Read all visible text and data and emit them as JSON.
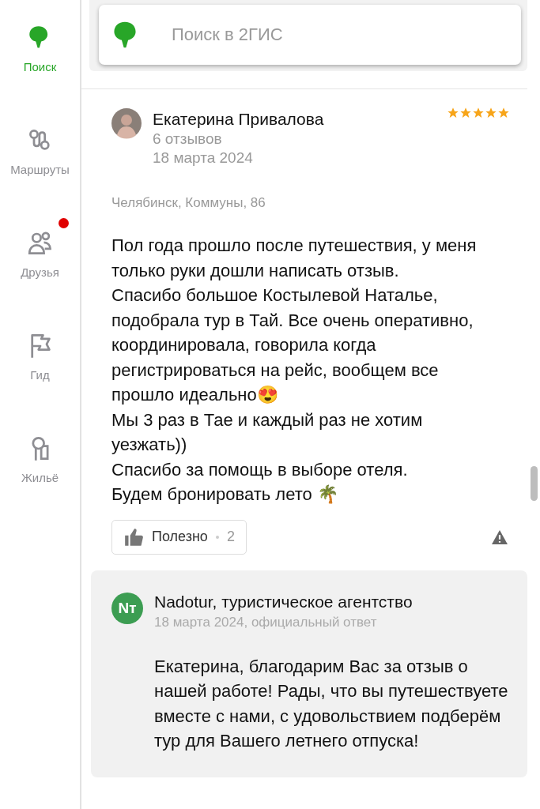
{
  "sidebar": {
    "items": [
      {
        "label": "Поиск",
        "kind": "search",
        "selected": true,
        "notification": false
      },
      {
        "label": "Маршруты",
        "kind": "routes",
        "selected": false,
        "notification": false
      },
      {
        "label": "Друзья",
        "kind": "friends",
        "selected": false,
        "notification": true
      },
      {
        "label": "Гид",
        "kind": "guide",
        "selected": false,
        "notification": false
      },
      {
        "label": "Жильё",
        "kind": "housing",
        "selected": false,
        "notification": false
      }
    ]
  },
  "search": {
    "placeholder": "Поиск в 2ГИС"
  },
  "review": {
    "author": "Екатерина Привалова",
    "reviews_count": "6 отзывов",
    "date": "18 марта 2024",
    "stars": 5,
    "address": "Челябинск, Коммуны, 86",
    "text": "Пол года прошло после путешествия, у меня только руки дошли написать отзыв.\nСпасибо большое Костылевой Наталье, подобрала тур в Тай. Все очень оперативно, координировала, говорила когда регистрироваться на рейс, вообщем все прошло идеально😍\nМы 3 раз в Тае и каждый раз не хотим уезжать))\nСпасибо за помощь в выборе отеля.\nБудем бронировать лето 🌴",
    "helpful": {
      "label": "Полезно",
      "count": "2"
    }
  },
  "reply": {
    "avatar": "Nт",
    "author": "Nadotur, туристическое агентство",
    "meta": "18 марта 2024, официальный ответ",
    "text": "Екатерина, благодарим Вас за отзыв о нашей работе! Рады, что вы путешествуете вместе с нами, с удовольствием подберём тур для Вашего летнего отпуска!"
  }
}
